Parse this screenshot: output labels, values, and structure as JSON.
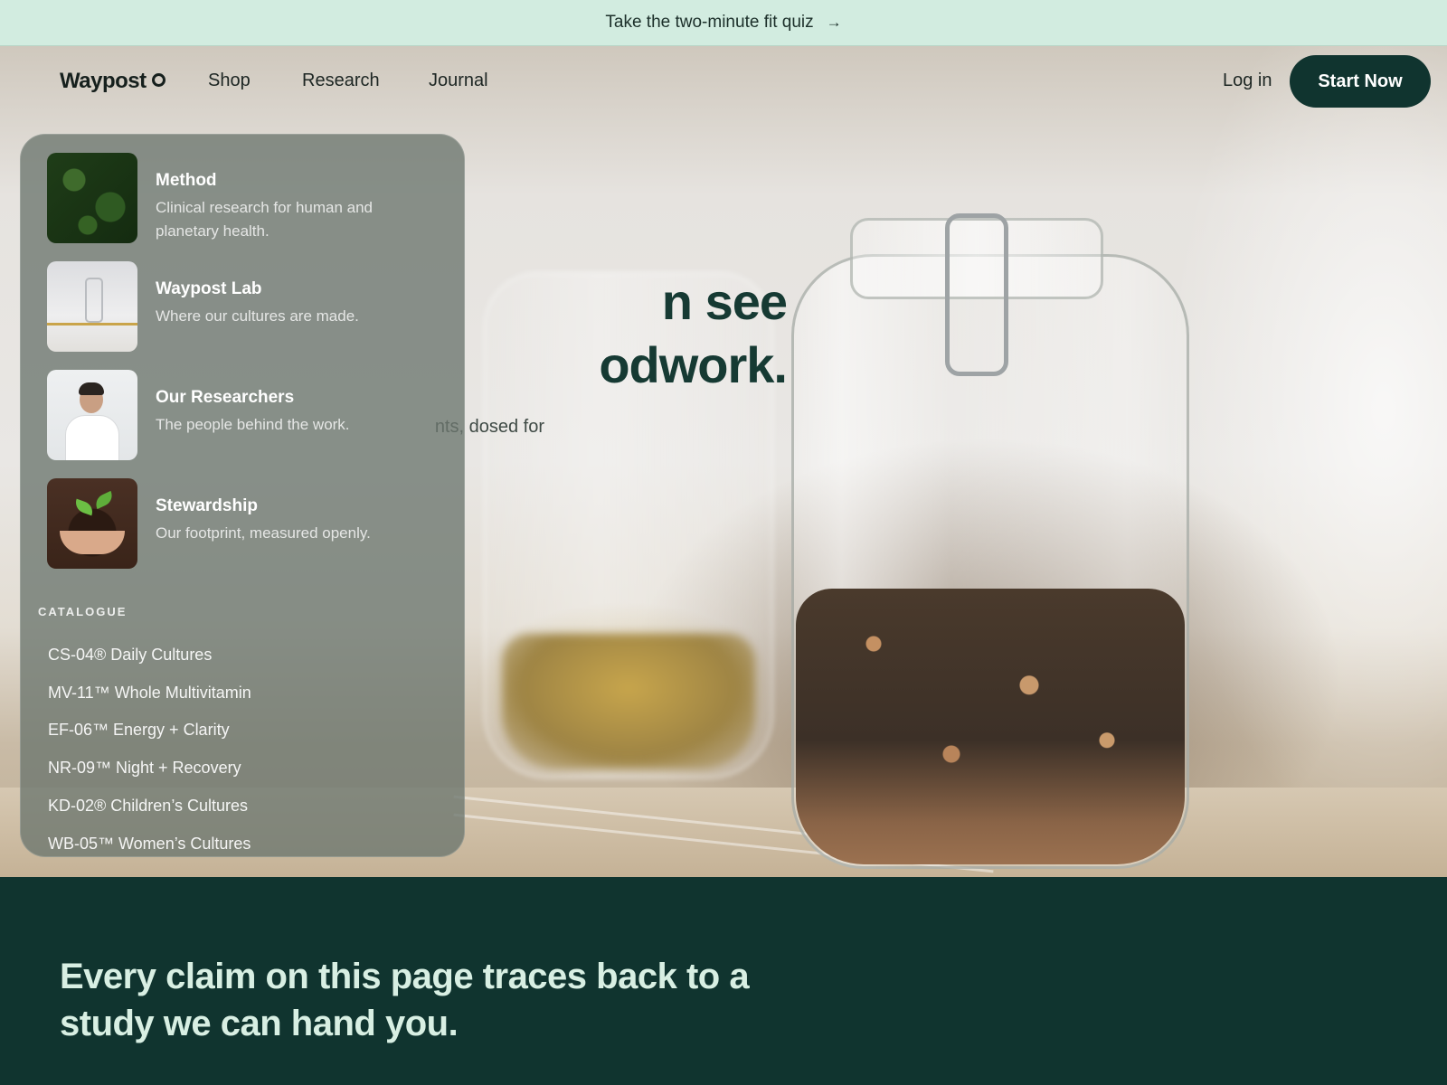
{
  "announcement": {
    "text": "Take the two-minute fit quiz",
    "arrow": "→"
  },
  "brand": {
    "name": "Waypost",
    "accent": "#10342f",
    "announce_bg": "#d2ece0"
  },
  "nav": {
    "links": [
      "Shop",
      "Research",
      "Journal"
    ],
    "login": "Log in",
    "cta": "Start Now"
  },
  "hero": {
    "title_line1": "n see",
    "title_line2": "odwork.",
    "subtitle": "nts, dosed for"
  },
  "menu": {
    "items": [
      {
        "title": "Method",
        "desc": "Clinical research for human and planetary health.",
        "thumb": "moss-image"
      },
      {
        "title": "Waypost Lab",
        "desc": "Where our cultures are made.",
        "thumb": "lab-image"
      },
      {
        "title": "Our Researchers",
        "desc": "The people behind the work.",
        "thumb": "researcher-image"
      },
      {
        "title": "Stewardship",
        "desc": "Our footprint, measured openly.",
        "thumb": "seedling-image"
      }
    ],
    "catalogue_label": "CATALOGUE",
    "catalogue": [
      "CS-04® Daily Cultures",
      "MV-11™ Whole Multivitamin",
      "EF-06™ Energy + Clarity",
      "NR-09™ Night + Recovery",
      "KD-02® Children’s Cultures",
      "WB-05™ Women’s Cultures"
    ]
  },
  "band": {
    "title": "Every claim on this page traces back to a study we can hand you."
  }
}
